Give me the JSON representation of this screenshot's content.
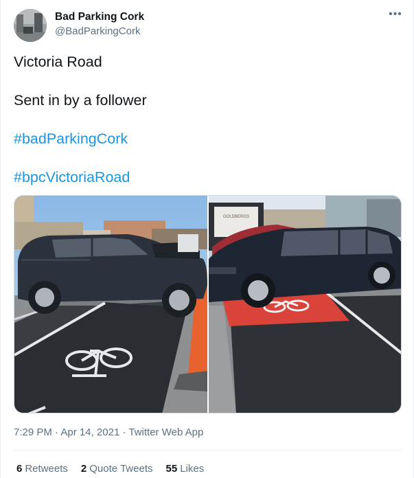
{
  "user": {
    "display_name": "Bad Parking Cork",
    "handle": "@BadParkingCork"
  },
  "tweet": {
    "lines": [
      "Victoria Road",
      "Sent in by a follower"
    ],
    "hashtags": [
      "#badParkingCork",
      "#bpcVictoriaRoad"
    ]
  },
  "media": {
    "photo_count": 2,
    "right_photo_sign_text": "GOLDBERGS"
  },
  "meta": {
    "time": "7:29 PM",
    "date": "Apr 14, 2021",
    "app": "Twitter Web App",
    "separator": "·"
  },
  "stats": {
    "retweets_count": "6",
    "retweets_label": "Retweets",
    "quote_count": "2",
    "quote_label": "Quote Tweets",
    "likes_count": "55",
    "likes_label": "Likes"
  },
  "colors": {
    "link": "#1b95e0",
    "secondary_text": "#5b7083",
    "primary_text": "#0f1419",
    "bike_lane_red": "#d9433a"
  },
  "icons": {
    "more": "more-horizontal-icon"
  }
}
